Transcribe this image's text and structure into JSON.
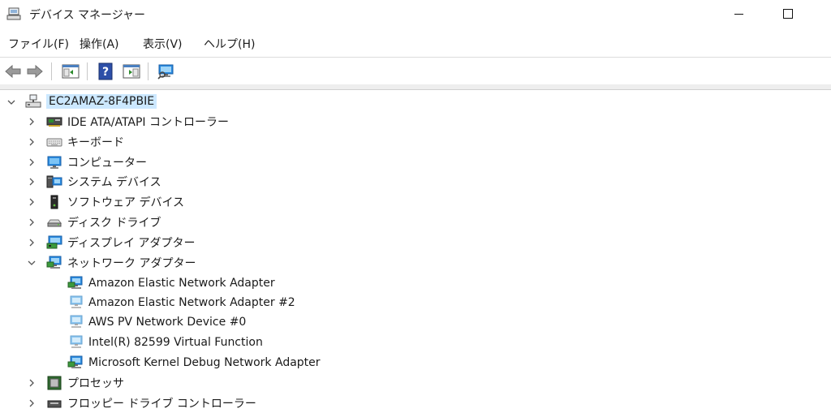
{
  "window": {
    "title": "デバイス マネージャー"
  },
  "menu": {
    "file": "ファイル(F)",
    "action": "操作(A)",
    "view": "表示(V)",
    "help": "ヘルプ(H)"
  },
  "tree": {
    "root": "EC2AMAZ-8F4PBIE",
    "ide": "IDE ATA/ATAPI コントローラー",
    "keyboard": "キーボード",
    "computer": "コンピューター",
    "system": "システム デバイス",
    "software": "ソフトウェア デバイス",
    "disk": "ディスク ドライブ",
    "display": "ディスプレイ アダプター",
    "network": "ネットワーク アダプター",
    "network_children": [
      "Amazon Elastic Network Adapter",
      "Amazon Elastic Network Adapter #2",
      "AWS PV Network Device #0",
      "Intel(R) 82599 Virtual Function",
      "Microsoft Kernel Debug Network Adapter"
    ],
    "processor": "プロセッサ",
    "floppy": "フロッピー ドライブ コントローラー"
  },
  "colors": {
    "selection": "#cce8ff",
    "accent": "#1e7fd6"
  }
}
